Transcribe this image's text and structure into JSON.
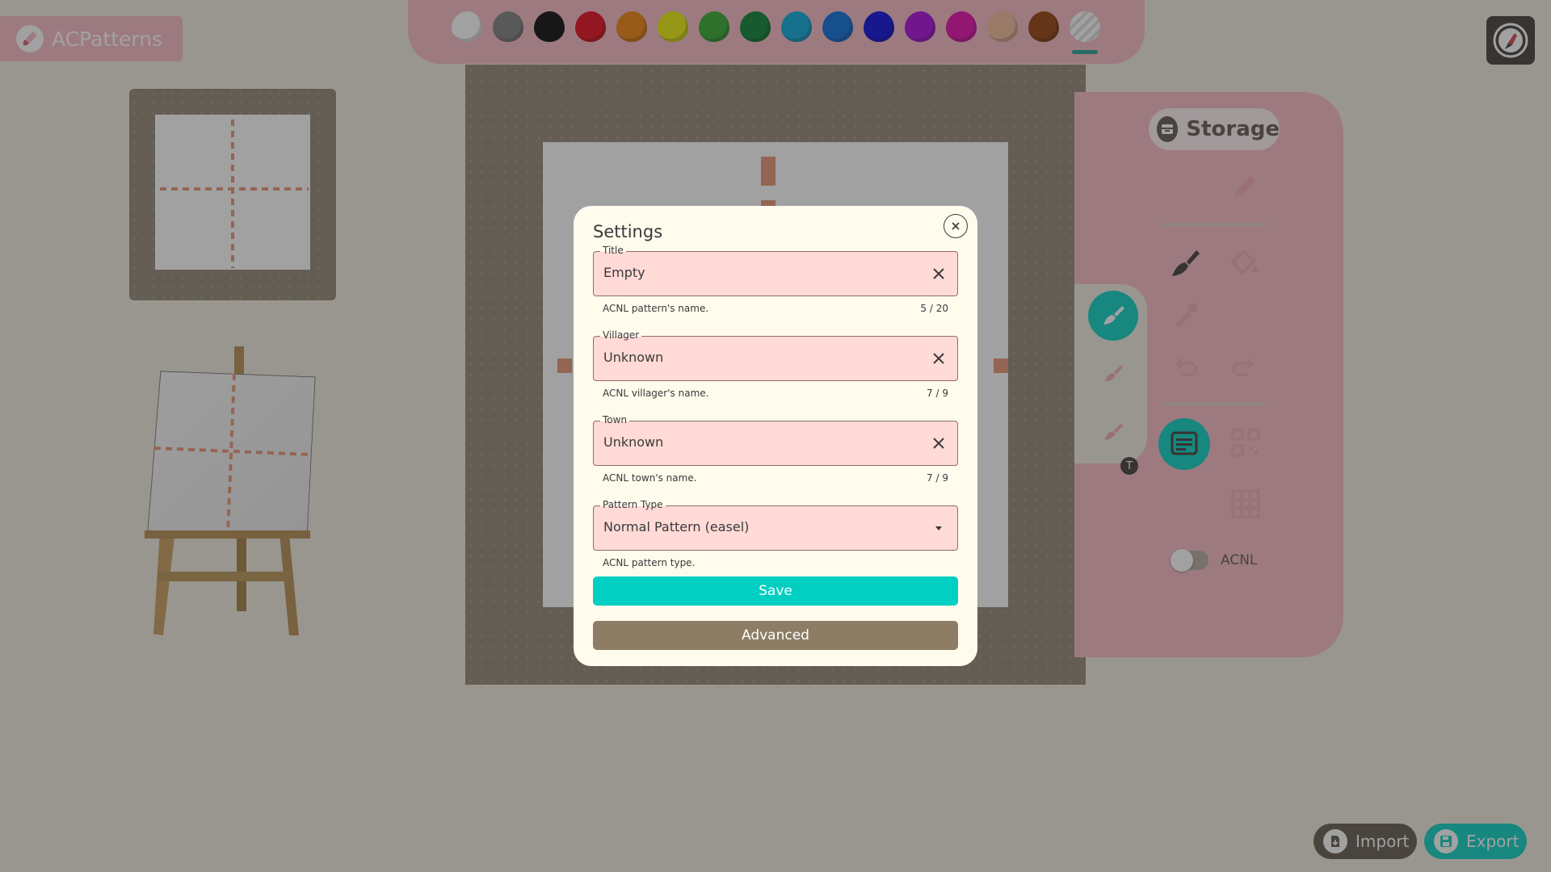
{
  "app": {
    "name": "ACPatterns"
  },
  "palette": {
    "colors": [
      "#ffffff",
      "#7b7b7b",
      "#000000",
      "#e50012",
      "#ef7d00",
      "#eaea00",
      "#2aa62a",
      "#007d2b",
      "#00a5d8",
      "#0068d8",
      "#0000dc",
      "#a600d8",
      "#e400a8",
      "#f0b895",
      "#8e3800",
      "#eeeeee"
    ],
    "selected_index": 15,
    "swatch_icon": "swatch-blob",
    "transparent_swatch_icon": "hatched-swatch-icon"
  },
  "storage": {
    "label": "Storage",
    "icon": "archive-icon"
  },
  "tools": {
    "pencil_icon": "pencil-icon",
    "brush_icon": "brush-icon",
    "fill_icon": "paint-bucket-icon",
    "eyedropper_icon": "eyedropper-icon",
    "undo_icon": "undo-icon",
    "redo_icon": "redo-icon",
    "settings_icon": "notes-icon",
    "qr_icon": "qr-code-icon",
    "grid_icon": "grid-icon",
    "brush_size_badge": "T"
  },
  "toggle": {
    "label": "ACNL",
    "on": false
  },
  "bottom": {
    "import_label": "Import",
    "export_label": "Export"
  },
  "colors": {
    "accent": "#00cfc1",
    "panel_pink": "#f7b7c3",
    "field_bg": "#ffdad6",
    "brown": "#8d7d64"
  },
  "modal": {
    "title": "Settings",
    "title_field": {
      "legend": "Title",
      "value": "Empty",
      "helper": "ACNL pattern's name.",
      "counter": "5 / 20"
    },
    "villager_field": {
      "legend": "Villager",
      "value": "Unknown",
      "helper": "ACNL villager's name.",
      "counter": "7 / 9"
    },
    "town_field": {
      "legend": "Town",
      "value": "Unknown",
      "helper": "ACNL town's name.",
      "counter": "7 / 9"
    },
    "type_field": {
      "legend": "Pattern Type",
      "value": "Normal Pattern (easel)",
      "helper": "ACNL pattern type."
    },
    "save_label": "Save",
    "advanced_label": "Advanced"
  }
}
